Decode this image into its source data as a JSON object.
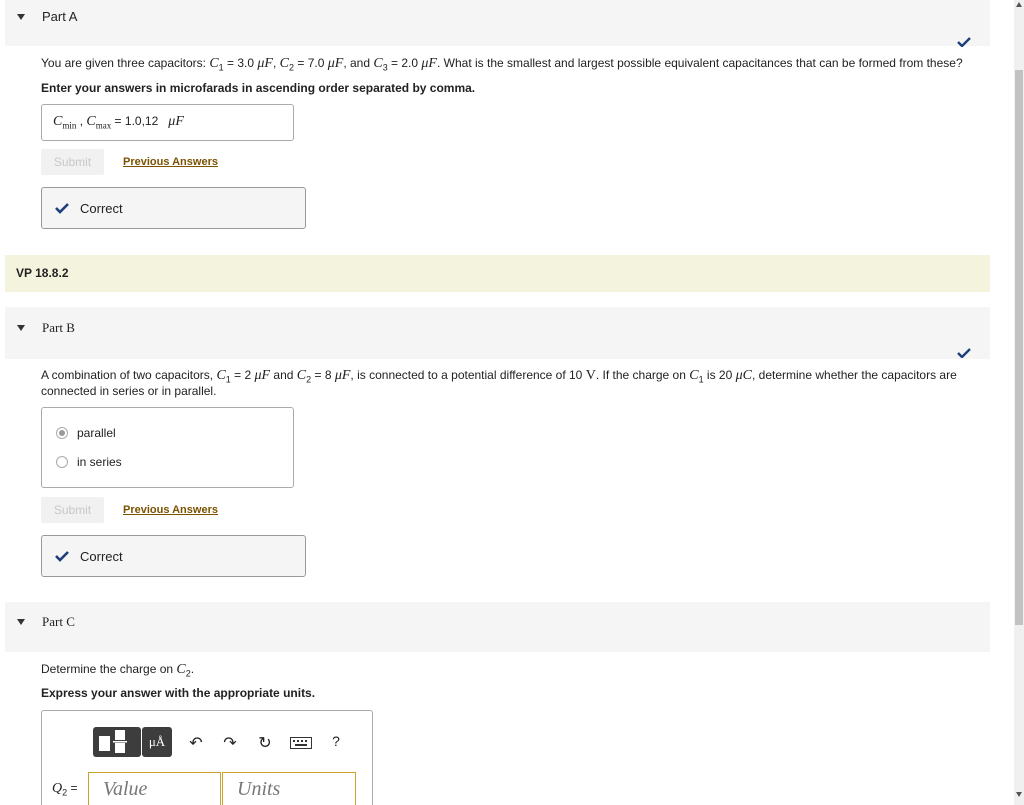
{
  "partA": {
    "title": "Part A",
    "problem_pre": "You are given three capacitors: ",
    "c1": "C",
    "c1_sub": "1",
    "c1_val": " = 3.0 ",
    "unit_uF": "μF",
    "sep1": ", ",
    "c2": "C",
    "c2_sub": "2",
    "c2_val": " = 7.0 ",
    "sep2": ", and ",
    "c3": "C",
    "c3_sub": "3",
    "c3_val": " = 2.0 ",
    "problem_post": ". What is the smallest and largest possible equivalent capacitances that can be formed from these?",
    "instruction": "Enter your answers in microfarads in ascending order separated by comma.",
    "answer_label_c": "C",
    "answer_label_min": "min",
    "answer_label_comma": " , ",
    "answer_label_c2": "C",
    "answer_label_max": "max",
    "answer_eq": " = ",
    "answer_value": "1.0,12",
    "answer_unit": "μF",
    "submit_label": "Submit",
    "previous_label": "Previous Answers",
    "feedback": "Correct"
  },
  "vp": {
    "label": "VP 18.8.2"
  },
  "partB": {
    "title": "Part B",
    "problem_1": "A combination of two capacitors, ",
    "c1": "C",
    "c1_sub": "1",
    "c1_val": " = 2 ",
    "unit_uF": "μF",
    "and": " and ",
    "c2": "C",
    "c2_sub": "2",
    "c2_val": " = 8 ",
    "problem_2": ", is connected to a potential difference of 10 ",
    "volt": "V",
    "problem_3": ". If the charge on ",
    "c1b": "C",
    "c1b_sub": "1",
    "problem_4": " is 20 ",
    "unit_uC": "μC",
    "problem_5": ", determine whether the capacitors are",
    "problem_line2": "connected in series or in parallel.",
    "options": [
      "parallel",
      "in series"
    ],
    "selected": "parallel",
    "submit_label": "Submit",
    "previous_label": "Previous Answers",
    "feedback": "Correct"
  },
  "partC": {
    "title": "Part C",
    "problem_pre": "Determine the charge on ",
    "c2": "C",
    "c2_sub": "2",
    "problem_post": ".",
    "instruction": "Express your answer with the appropriate units.",
    "toolbar_units": "μÅ",
    "help": "?",
    "q_label": "Q",
    "q_sub": "2",
    "q_eq": " =",
    "value_placeholder": "Value",
    "units_placeholder": "Units"
  },
  "colors": {
    "check": "#1d3f7a",
    "link": "#7a5200",
    "vp_bg": "#f4f4de",
    "header_bg": "#f5f5f5",
    "field_border": "#c9a32e"
  }
}
